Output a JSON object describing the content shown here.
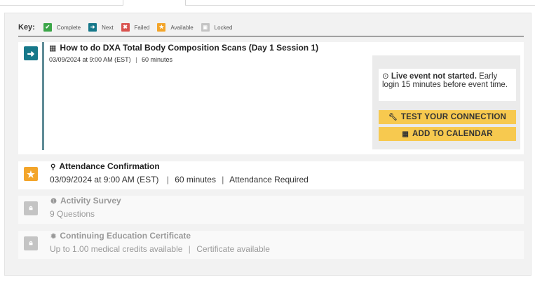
{
  "key": {
    "title": "Key:",
    "items": [
      {
        "label": "Complete",
        "color": "#3ba648",
        "icon": "check-icon",
        "glyph": "✔"
      },
      {
        "label": "Next",
        "color": "#16788a",
        "icon": "arrow-right-icon",
        "glyph": "➜"
      },
      {
        "label": "Failed",
        "color": "#d9534f",
        "icon": "x-icon",
        "glyph": "✖"
      },
      {
        "label": "Available",
        "color": "#f3a52a",
        "icon": "star-icon",
        "glyph": "★"
      },
      {
        "label": "Locked",
        "color": "#c4c4c4",
        "icon": "lock-icon",
        "glyph": "▣"
      }
    ]
  },
  "session": {
    "status_icon": "arrow-right-icon",
    "title": "How to do DXA Total Body Composition Scans (Day 1 Session 1)",
    "datetime": "03/09/2024 at 9:00 AM (EST)",
    "separator": "|",
    "duration": "60 minutes",
    "live_status_bold": "Live event not started.",
    "live_status_text": " Early login 15 minutes before event time.",
    "test_button": "TEST YOUR CONNECTION",
    "calendar_button": "ADD TO CALENDAR"
  },
  "attendance": {
    "status_icon": "star-icon",
    "title": "Attendance Confirmation",
    "datetime": "03/09/2024 at 9:00 AM (EST)",
    "duration": "60 minutes",
    "requirement": "Attendance Required"
  },
  "survey": {
    "status_icon": "lock-icon",
    "title": "Activity Survey",
    "detail": "9 Questions"
  },
  "certificate": {
    "status_icon": "lock-icon",
    "title": "Continuing Education Certificate",
    "credits": "Up to 1.00 medical credits available",
    "availability": "Certificate available"
  },
  "colors": {
    "next": "#16788a",
    "available": "#f3a52a",
    "locked": "#c4c4c4",
    "button": "#f7c94f"
  }
}
